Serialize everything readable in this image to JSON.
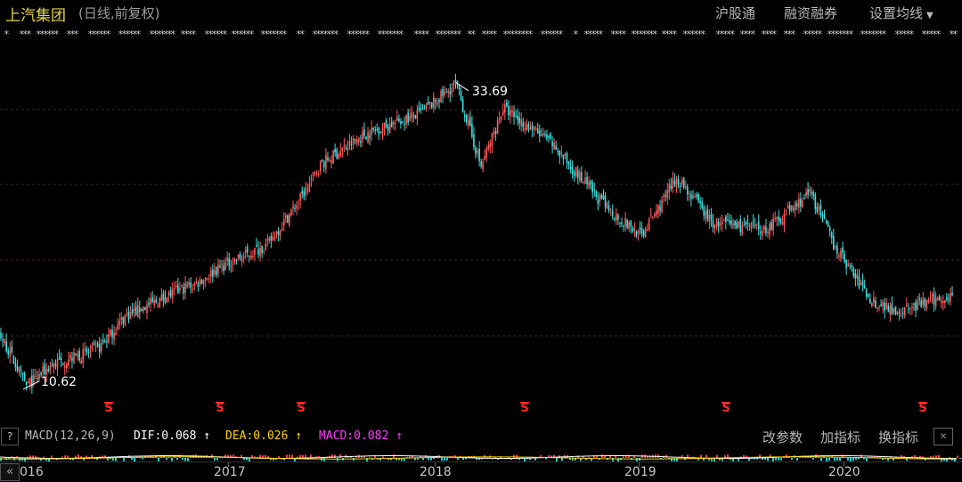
{
  "header": {
    "title": "上汽集团",
    "subtitle": "(日线,前复权)",
    "buttons": [
      "沪股通",
      "融资融券",
      "设置均线"
    ]
  },
  "chart": {
    "high_label": "33.69",
    "low_label": "10.62",
    "up_color": "#ff5a5a",
    "down_color": "#3fe0e0",
    "grid_color": "#4a1f1f"
  },
  "indicator": {
    "name": "MACD(12,26,9)",
    "dif": "DIF:0.068",
    "dea": "DEA:0.026",
    "macd": "MACD:0.082",
    "buttons": [
      "改参数",
      "加指标",
      "换指标"
    ],
    "help": "?",
    "close": "✕",
    "dif_color": "#ffffff",
    "dea_color": "#ffd400",
    "macd_color": "#ff3cff"
  },
  "xaxis": {
    "labels": [
      "016",
      "2017",
      "2018",
      "2019",
      "2020"
    ],
    "nav": "«"
  },
  "s_marks": [
    "S",
    "S",
    "S",
    "S",
    "S",
    "S"
  ],
  "chart_data": {
    "type": "line",
    "title": "上汽集团",
    "x": [
      "2016",
      "2016",
      "2016",
      "2016",
      "2016",
      "2017",
      "2017",
      "2017",
      "2017",
      "2017",
      "2017",
      "2017",
      "2018",
      "2018",
      "2018",
      "2018",
      "2018",
      "2018",
      "2019",
      "2019",
      "2019",
      "2019",
      "2019",
      "2019",
      "2020",
      "2020",
      "2020",
      "2020"
    ],
    "series": [
      {
        "values": [
          14.6,
          11.9,
          10.6,
          12.3,
          13.4,
          15.9,
          18.4,
          16.4,
          19.8,
          21.4,
          25.2,
          27.6,
          29.9,
          31.4,
          33.69,
          27.4,
          31.9,
          29.1,
          24.3,
          22.1,
          26.6,
          23.1,
          22.6,
          25.4,
          21.6,
          17.1,
          16.3,
          17.6
        ]
      }
    ],
    "ylim": [
      10,
      36
    ]
  }
}
